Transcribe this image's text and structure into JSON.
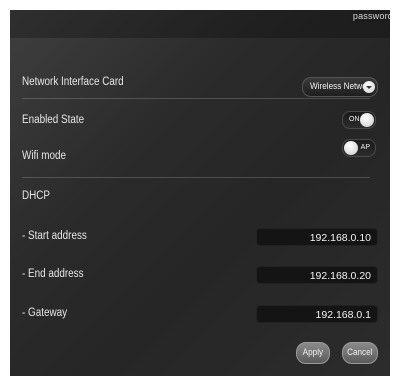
{
  "header": {
    "password_link": "password"
  },
  "nic": {
    "label": "Network Interface Card",
    "value": "Wireless Network"
  },
  "enabled_state": {
    "label": "Enabled State",
    "toggle_text": "ON",
    "on": true
  },
  "wifi_mode": {
    "label": "Wifi mode",
    "toggle_text": "AP",
    "on": false
  },
  "dhcp": {
    "heading": "DHCP",
    "start": {
      "label": "- Start address",
      "value": "192.168.0.10"
    },
    "end": {
      "label": "- End address",
      "value": "192.168.0.20"
    },
    "gateway": {
      "label": "- Gateway",
      "value": "192.168.0.1"
    }
  },
  "actions": {
    "apply_label": "Apply",
    "cancel_label": "Cancel"
  }
}
